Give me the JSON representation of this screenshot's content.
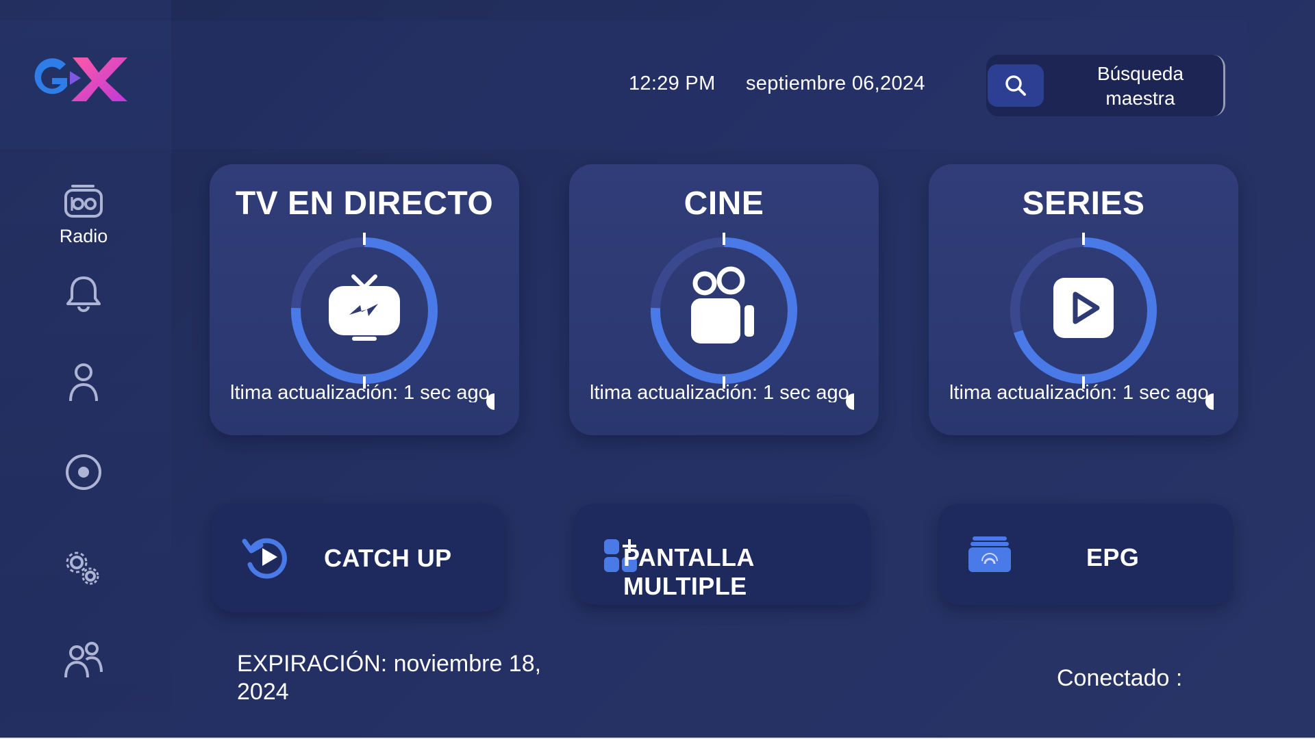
{
  "header": {
    "brand_logo": "GX",
    "time": "12:29 PM",
    "date": "septiembre 06,2024",
    "search": {
      "label": "Búsqueda maestra",
      "icon": "search-icon"
    }
  },
  "sidebar": {
    "items": [
      {
        "label": "Radio",
        "icon": "radio-icon"
      },
      {
        "label": "",
        "icon": "bell-icon"
      },
      {
        "label": "",
        "icon": "user-icon"
      },
      {
        "label": "",
        "icon": "record-icon"
      },
      {
        "label": "",
        "icon": "settings-gears-icon"
      },
      {
        "label": "",
        "icon": "users-icon"
      }
    ]
  },
  "cards": [
    {
      "title": "TV EN DIRECTO",
      "update": "ltima actualización: 1 sec ago",
      "icon": "live-tv-icon"
    },
    {
      "title": "CINE",
      "update": "ltima actualización: 1 sec ago",
      "icon": "movie-camera-icon"
    },
    {
      "title": "SERIES",
      "update": "ltima actualización: 1 sec ago",
      "icon": "play-icon"
    }
  ],
  "buttons": {
    "catch_up": "CATCH UP",
    "multiscreen": "PANTALLA MULTIPLE",
    "epg": "EPG"
  },
  "footer": {
    "expiration": "EXPIRACIÓN: noviembre 18, 2024",
    "connected": "Conectado :"
  },
  "colors": {
    "background": "#243063",
    "card": "#2f3c77",
    "button": "#1e2a5e",
    "accent_blue": "#3f6fe0",
    "logo_blue": "#2f7de8",
    "logo_pink": "#ff4fa0"
  }
}
